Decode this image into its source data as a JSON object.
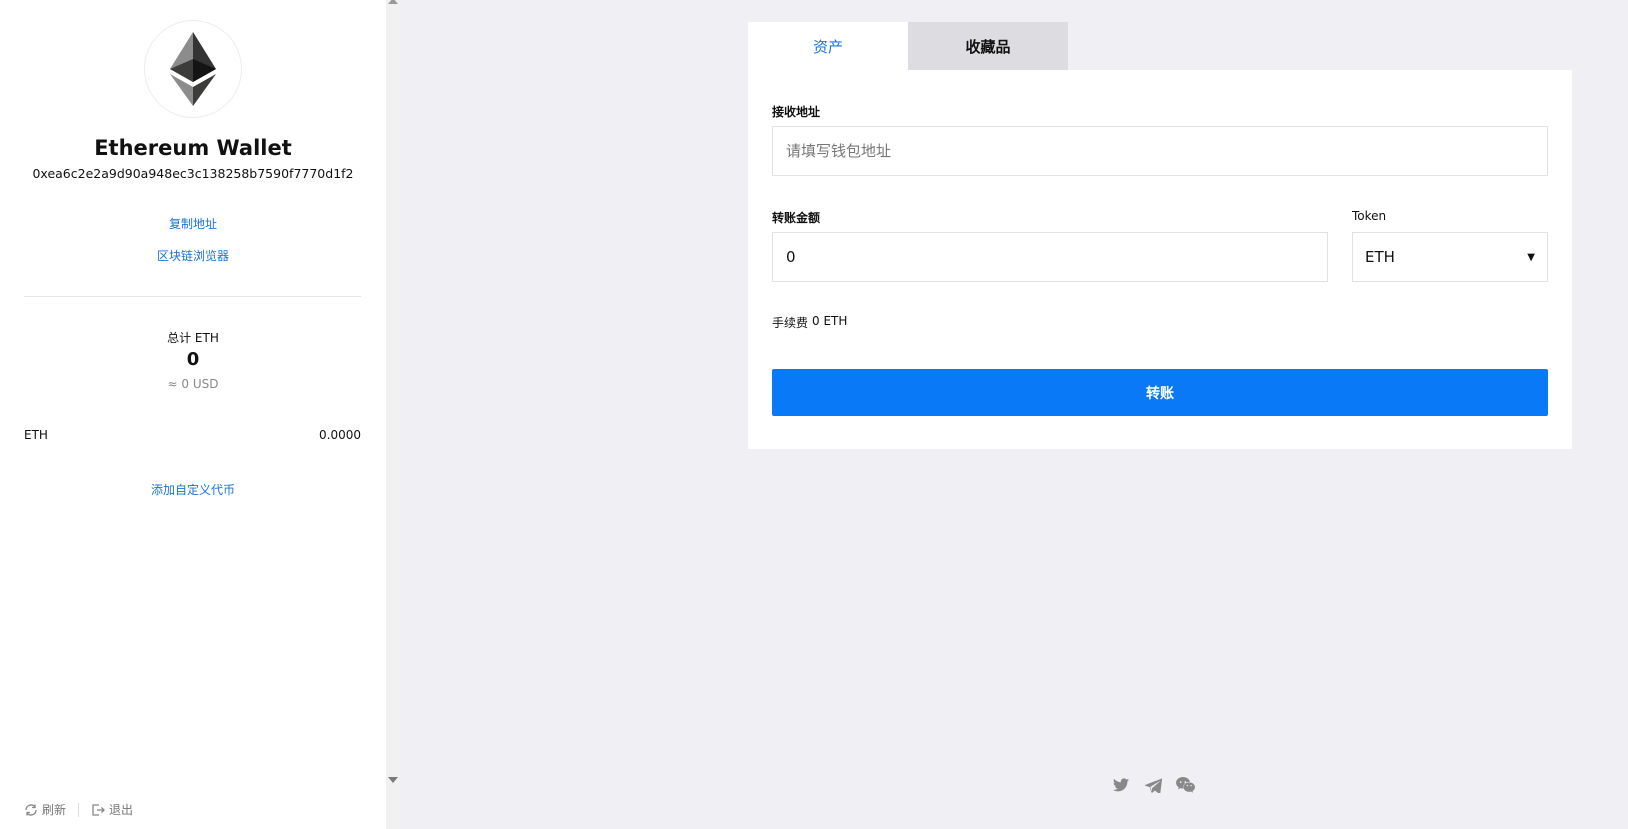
{
  "sidebar": {
    "logo_icon": "ethereum-logo-icon",
    "title": "Ethereum Wallet",
    "address": "0xea6c2e2a9d90a948ec3c138258b7590f7770d1f2",
    "copy_address_label": "复制地址",
    "explorer_label": "区块链浏览器",
    "total_label": "总计 ETH",
    "total_value": "0",
    "total_usd": "≈ 0 USD",
    "tokens": [
      {
        "symbol": "ETH",
        "balance": "0.0000"
      }
    ],
    "add_token_label": "添加自定义代币",
    "refresh_label": "刷新",
    "logout_label": "退出"
  },
  "tabs": [
    {
      "label": "资产",
      "active": true
    },
    {
      "label": "收藏品",
      "active": false
    }
  ],
  "form": {
    "recipient_label": "接收地址",
    "recipient_placeholder": "请填写钱包地址",
    "recipient_value": "",
    "amount_label": "转账金额",
    "amount_value": "0",
    "token_label": "Token",
    "token_selected": "ETH",
    "fee_label": "手续费",
    "fee_value": "0 ETH",
    "submit_label": "转账"
  },
  "social_icons": [
    "twitter-icon",
    "telegram-icon",
    "wechat-icon"
  ],
  "colors": {
    "accent": "#0a79f7",
    "link": "#1a73d9",
    "background": "#efeff4"
  }
}
